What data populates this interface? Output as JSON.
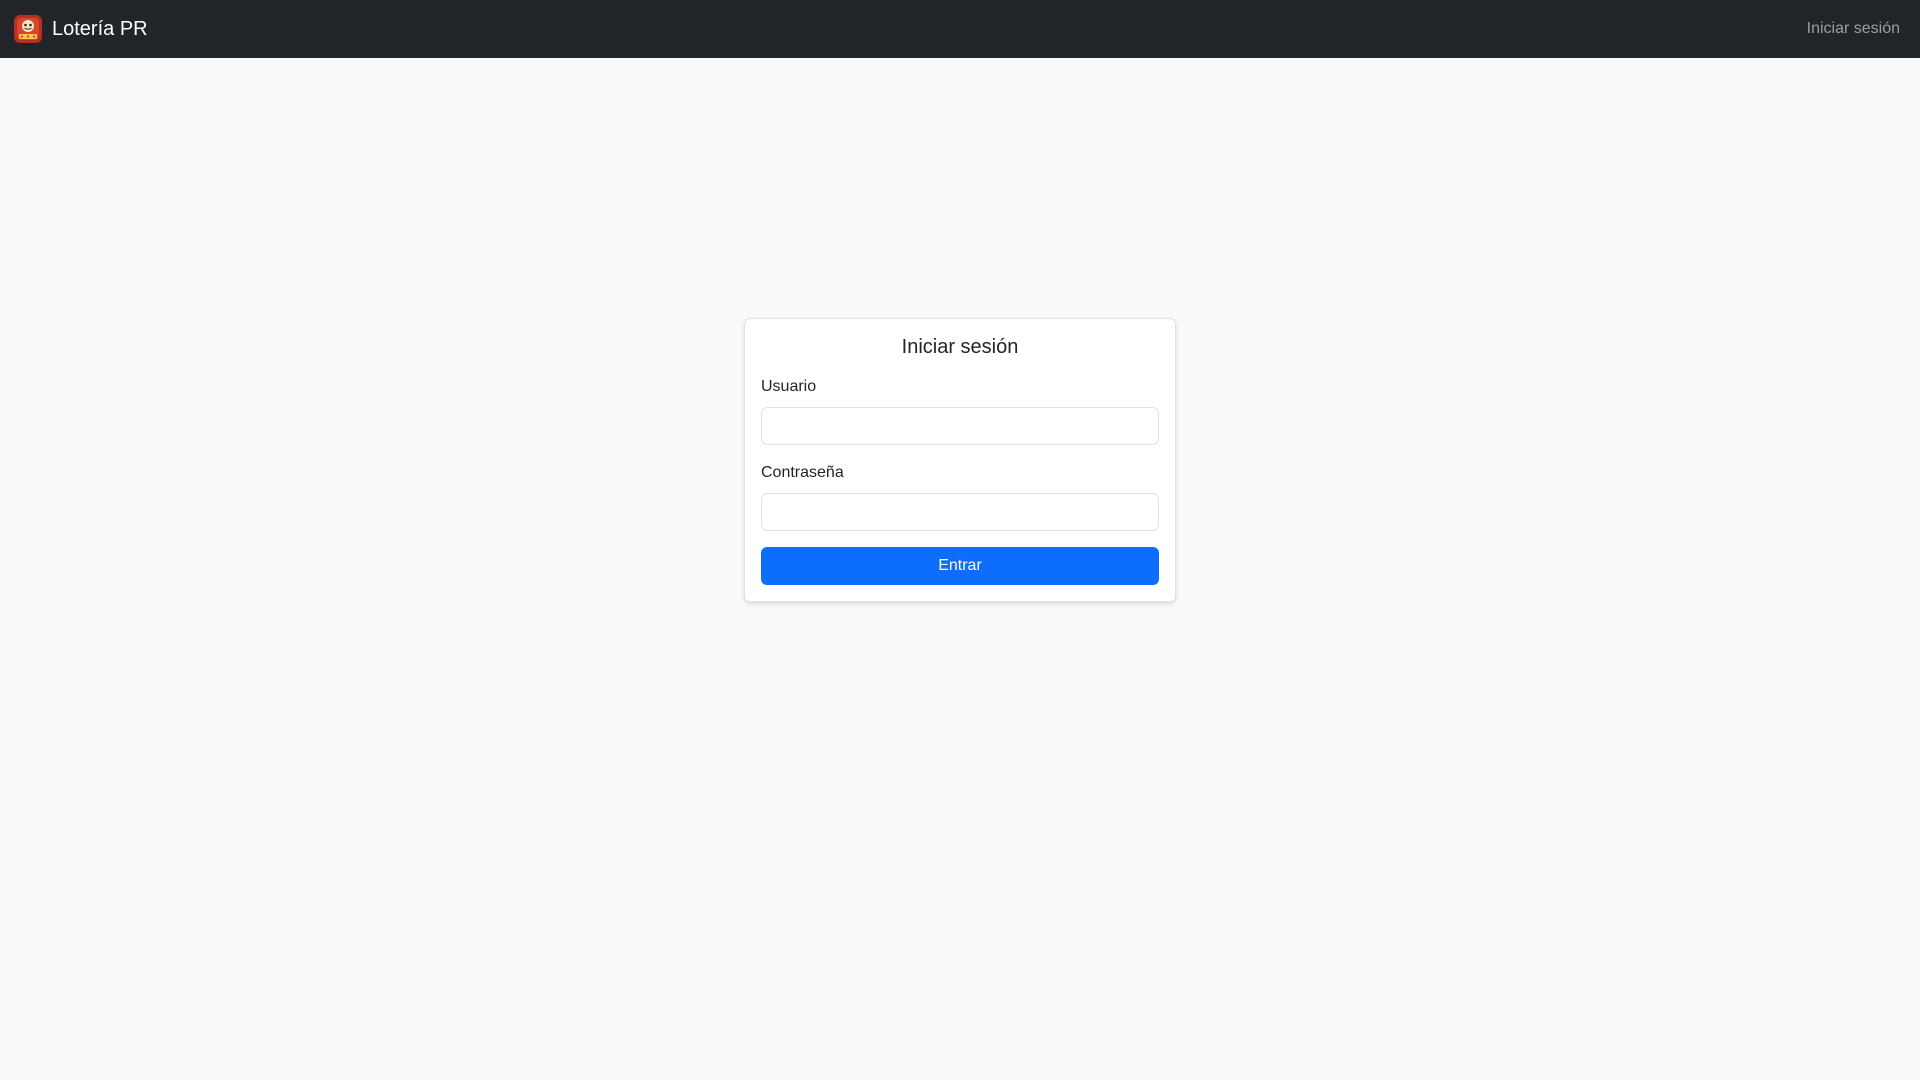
{
  "navbar": {
    "brand_text": "Lotería PR",
    "brand_logo_icon": "lottery-logo-icon",
    "login_link": "Iniciar sesión",
    "background_color": "#212529"
  },
  "login_form": {
    "title": "Iniciar sesión",
    "username_label": "Usuario",
    "username_value": "",
    "password_label": "Contraseña",
    "password_value": "",
    "submit_label": "Entrar",
    "accent_color": "#0d6efd"
  },
  "page": {
    "background_color": "#f8f9fa"
  }
}
